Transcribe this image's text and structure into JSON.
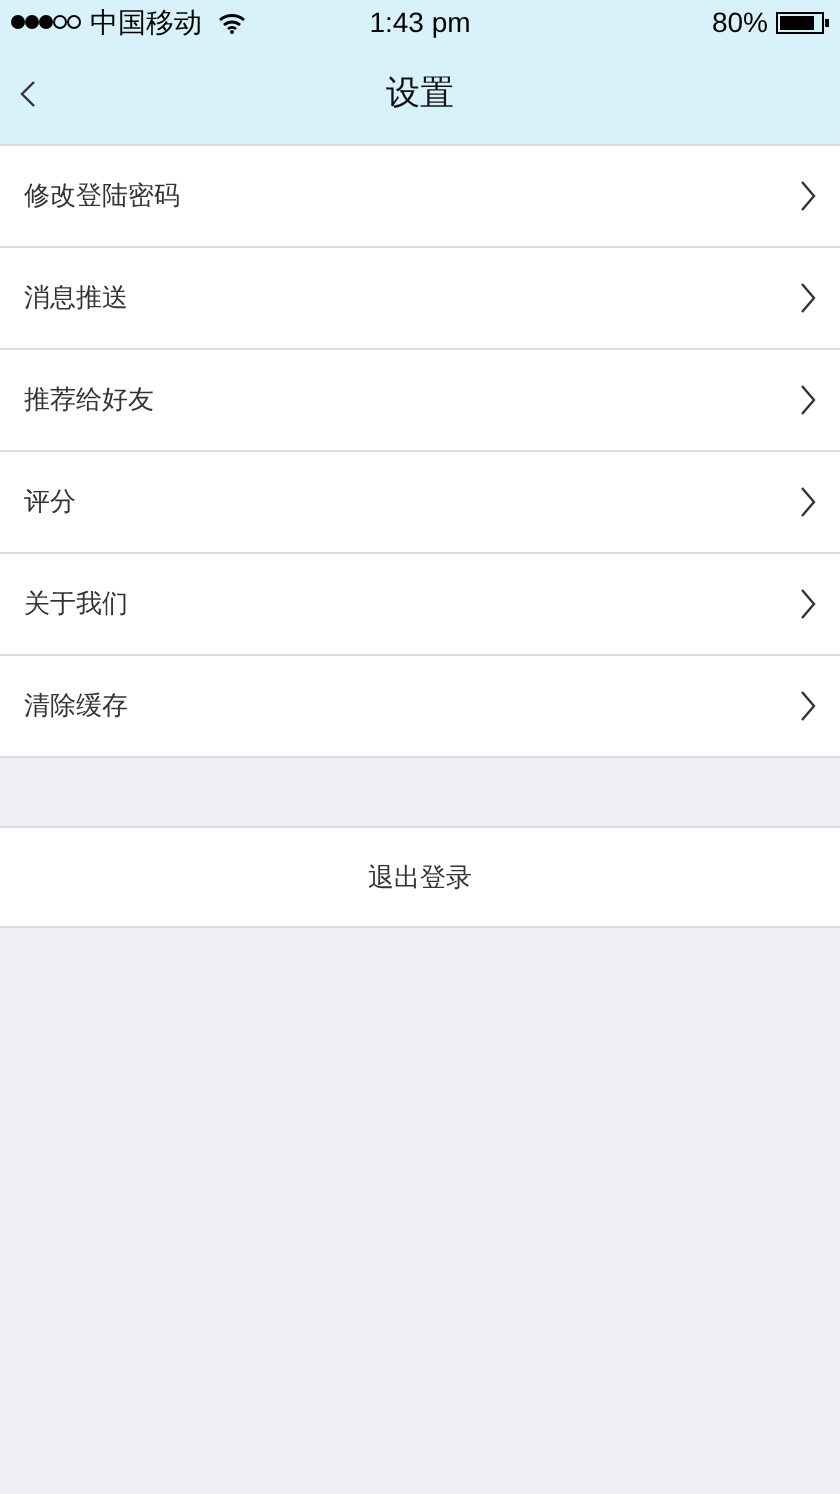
{
  "status_bar": {
    "carrier": "中国移动",
    "time": "1:43 pm",
    "battery": "80%"
  },
  "nav": {
    "title": "设置"
  },
  "menu": [
    {
      "label": "修改登陆密码"
    },
    {
      "label": "消息推送"
    },
    {
      "label": "推荐给好友"
    },
    {
      "label": "评分"
    },
    {
      "label": "关于我们"
    },
    {
      "label": "清除缓存"
    }
  ],
  "logout": {
    "label": "退出登录"
  }
}
